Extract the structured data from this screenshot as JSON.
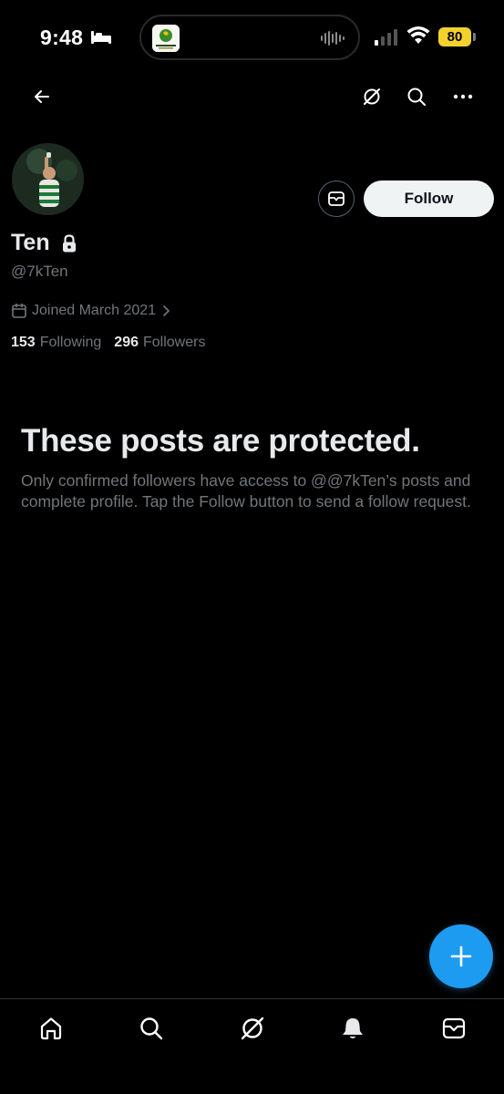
{
  "status_bar": {
    "time": "9:48",
    "battery": "80",
    "battery_color": "#f3d12e",
    "icons": [
      "sleep-focus-icon",
      "cellular-signal-icon",
      "wifi-icon",
      "battery-icon"
    ]
  },
  "top_nav": {
    "icons": [
      "arrow-left-icon",
      "grok-icon",
      "search-icon",
      "more-icon"
    ]
  },
  "profile": {
    "display_name": "Ten",
    "handle": "@7kTen",
    "joined": "Joined March 2021",
    "following_count": "153",
    "following_label": "Following",
    "followers_count": "296",
    "followers_label": "Followers",
    "follow_button": "Follow",
    "protected_lock": true
  },
  "protected": {
    "title": "These posts are protected.",
    "body": "Only confirmed followers have access to @@7kTen’s posts and complete profile. Tap the Follow button to send a follow request."
  },
  "colors": {
    "background": "#000000",
    "text_primary": "#e7e9ea",
    "text_secondary": "#71767b",
    "accent": "#1d9bf0",
    "follow_bg": "#eff3f4"
  },
  "bottom_nav": {
    "tabs": [
      "home-icon",
      "search-icon",
      "grok-icon",
      "notifications-icon",
      "messages-icon"
    ]
  }
}
